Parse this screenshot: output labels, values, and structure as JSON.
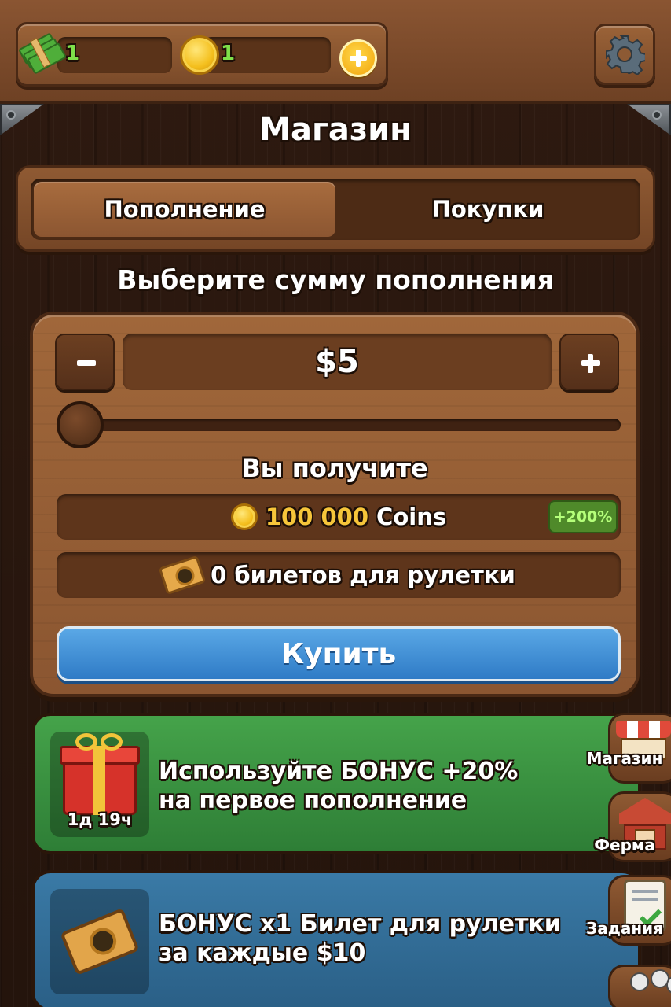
{
  "resources": {
    "cash_value": "1",
    "coins_value": "1"
  },
  "page_title": "Магазин",
  "tabs": [
    {
      "label": "Пополнение",
      "active": true
    },
    {
      "label": "Покупки",
      "active": false
    }
  ],
  "subtitle": "Выберите сумму пополнения",
  "amount": {
    "value": "$5",
    "slider_fraction": 0
  },
  "receive": {
    "label": "Вы получите",
    "coins_amount": "100 000",
    "coins_unit": "Coins",
    "bonus_badge": "+200%",
    "tickets_text": "0 билетов для рулетки"
  },
  "buy_button": "Купить",
  "bonuses": [
    {
      "line1": "Используйте БОНУС +20%",
      "line2": "на первое пополнение",
      "timer": "1д 19ч",
      "icon": "gift-icon"
    },
    {
      "line1": "БОНУС x1 Билет для рулетки",
      "line2": "за каждые $10",
      "icon": "ticket-icon"
    }
  ],
  "side_nav": [
    {
      "label": "Магазин",
      "icon": "shop-icon"
    },
    {
      "label": "Ферма",
      "icon": "barn-icon"
    },
    {
      "label": "Задания",
      "icon": "tasks-icon"
    },
    {
      "label": "",
      "icon": "friends-icon"
    }
  ],
  "colors": {
    "coins_text": "#f6c53a",
    "cash_text": "#7ee04a",
    "buy_button": "#2f7bc6",
    "bonus_green": "#2e7e36",
    "bonus_blue": "#2a5f86",
    "badge_text": "#b5ff7a"
  }
}
